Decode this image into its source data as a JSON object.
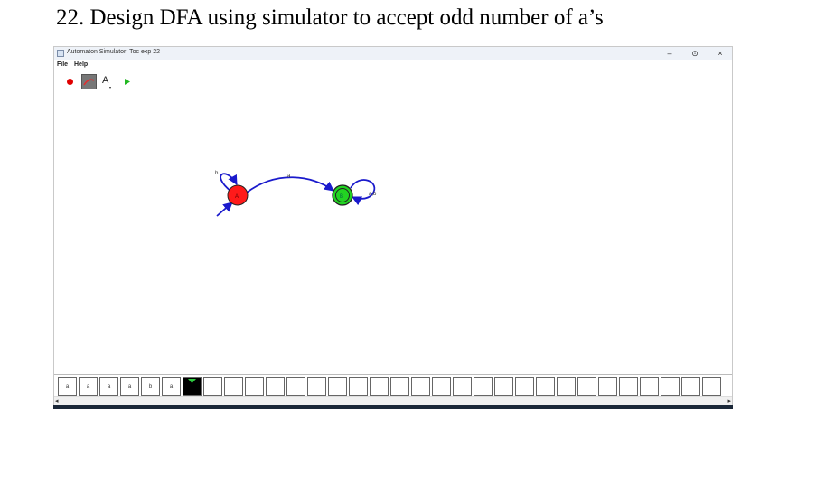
{
  "document": {
    "heading": "22. Design DFA using simulator to accept odd number of a’s"
  },
  "window": {
    "title": "Automaton Simulator: Toc exp 22",
    "minimize": "–",
    "restore": "⊙",
    "close": "×"
  },
  "menu": {
    "items": [
      "File",
      "Help"
    ]
  },
  "toolbar": {
    "tools": [
      {
        "icon": "add-state-icon"
      },
      {
        "icon": "add-transition-icon",
        "selected": true
      },
      {
        "icon": "text-tool-icon",
        "label": "A"
      },
      {
        "icon": "run-icon"
      }
    ],
    "colors": {
      "state_tool": "#e00000",
      "run": "#22b822"
    }
  },
  "automaton": {
    "states": [
      {
        "id": "A",
        "label": "A",
        "color": "#ff1a1a",
        "initial": true,
        "accepting": false
      },
      {
        "id": "B",
        "label": "B",
        "color": "#22d322",
        "initial": false,
        "accepting": true
      }
    ],
    "transitions": [
      {
        "from": "A",
        "to": "A",
        "label": "b"
      },
      {
        "from": "A",
        "to": "B",
        "label": "a"
      },
      {
        "from": "B",
        "to": "B",
        "label": "a,b"
      }
    ],
    "edge_color": "#1a1acc"
  },
  "tape": {
    "symbols": [
      "a",
      "a",
      "a",
      "a",
      "b",
      "a"
    ],
    "head_color": "#000000",
    "head_marker_color": "#2ecc40"
  },
  "scrollbar": {
    "left": "◂",
    "right": "▸"
  }
}
